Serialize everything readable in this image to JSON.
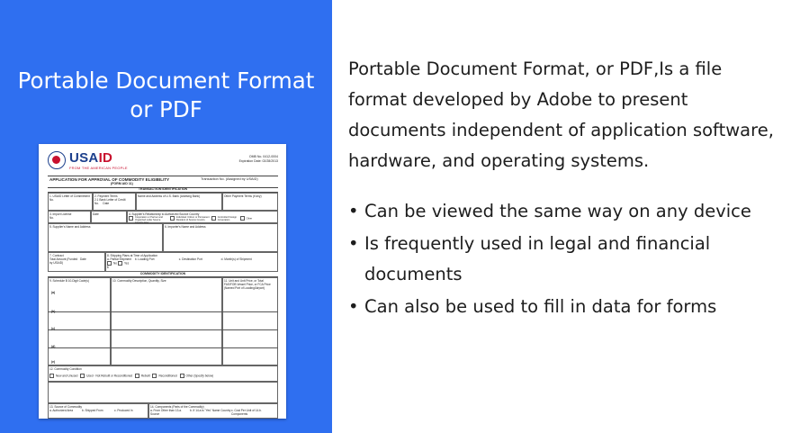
{
  "slide": {
    "title": "Portable Document Format\nor PDF",
    "paragraph": "Portable Document Format, or PDF,Is a file format developed by Adobe to present documents independent of application software, hardware, and operating systems.",
    "bullets": [
      "Can be viewed the same way on any device",
      "Is frequently used in legal and financial documents",
      "Can also be used to fill in data for forms"
    ]
  },
  "form": {
    "brand_prefix": "USA",
    "brand_suffix": "ID",
    "tagline": "FROM THE AMERICAN PEOPLE",
    "omb_line1": "OMB No. 0412-0004",
    "omb_line2": "Expiration Date: 02/28/2013",
    "title": "APPLICATION FOR APPROVAL OF COMMODITY ELIGIBILITY",
    "form_no": "(FORM AID 11)",
    "transaction": "Transaction No. (Assigned by USAID)",
    "section_transaction": "TRANSACTION IDENTIFICATION",
    "f1": "1. USAID Letter of Commitment No.",
    "f2": "2. Payment Terms",
    "f2a": "2.1 Bank Letter of Credit",
    "f2b_no": "No.",
    "f2b_date": "Date",
    "f3": "Name and Address of U.S. Bank (Advising Bank)",
    "f3b": "Other Payment Terms (if any)",
    "f4": "3. Import License",
    "f4_no": "No.",
    "f4_date": "Date",
    "f5": "4. Supplier's Relationship to Authorized Source Country",
    "f5a": "Corporation or Partner and Organized under Source Country laws",
    "f5b": "Individual: Citizen or Permanent Resident of Source Country",
    "f5c": "Controlled Foreign Corporation",
    "f5d": "Other",
    "f6": "5. Supplier's Name and Address",
    "f7": "6. Importer's Name and Address",
    "f8": "7. Contract",
    "f8a": "Total Amount (Funded by USAID)",
    "f8b": "Date",
    "f9": "8. Shipping Plans at Time of Application",
    "f9a": "a. Partial Shipment",
    "f9a2": "No",
    "f9a3": "Yes",
    "f9b": "b. Loading Port",
    "f9c": "c. Destination Port",
    "f9d": "d. Month(s) of Shipment",
    "f9e": "$",
    "section_commodity": "COMMODITY IDENTIFICATION",
    "c1": "9. Schedule B 10-Digit Code(s)",
    "c2": "10. Commodity Description, Quantity, Size",
    "c3": "11. Unit and Unit Price, or Total FAS/FOB Vessel Price, or FCA Price (Named Port of Loading/Airport)",
    "rows": [
      "(a)",
      "(b)",
      "(c)",
      "(d)",
      "(e)"
    ],
    "cond": "12. Commodity Condition",
    "cond_a": "New and Unused",
    "cond_b": "Used - Not Rebuilt or Reconditioned",
    "cond_c": "Rebuilt",
    "cond_d": "Reconditioned",
    "cond_e": "Other (Specify below)",
    "src": "13. Source of Commodity",
    "src_a": "a. Authorized Area",
    "src_b": "b. Shipped From",
    "src_c": "c. Produced In",
    "comp": "14. Components (Parts of the Commodity)",
    "comp_a": "a. From Other than 13.a. Source",
    "comp_b": "b. If 14.a is \"Yes\" Name Country",
    "comp_c": "c. Cost Per Unit of 14.b. Components"
  }
}
